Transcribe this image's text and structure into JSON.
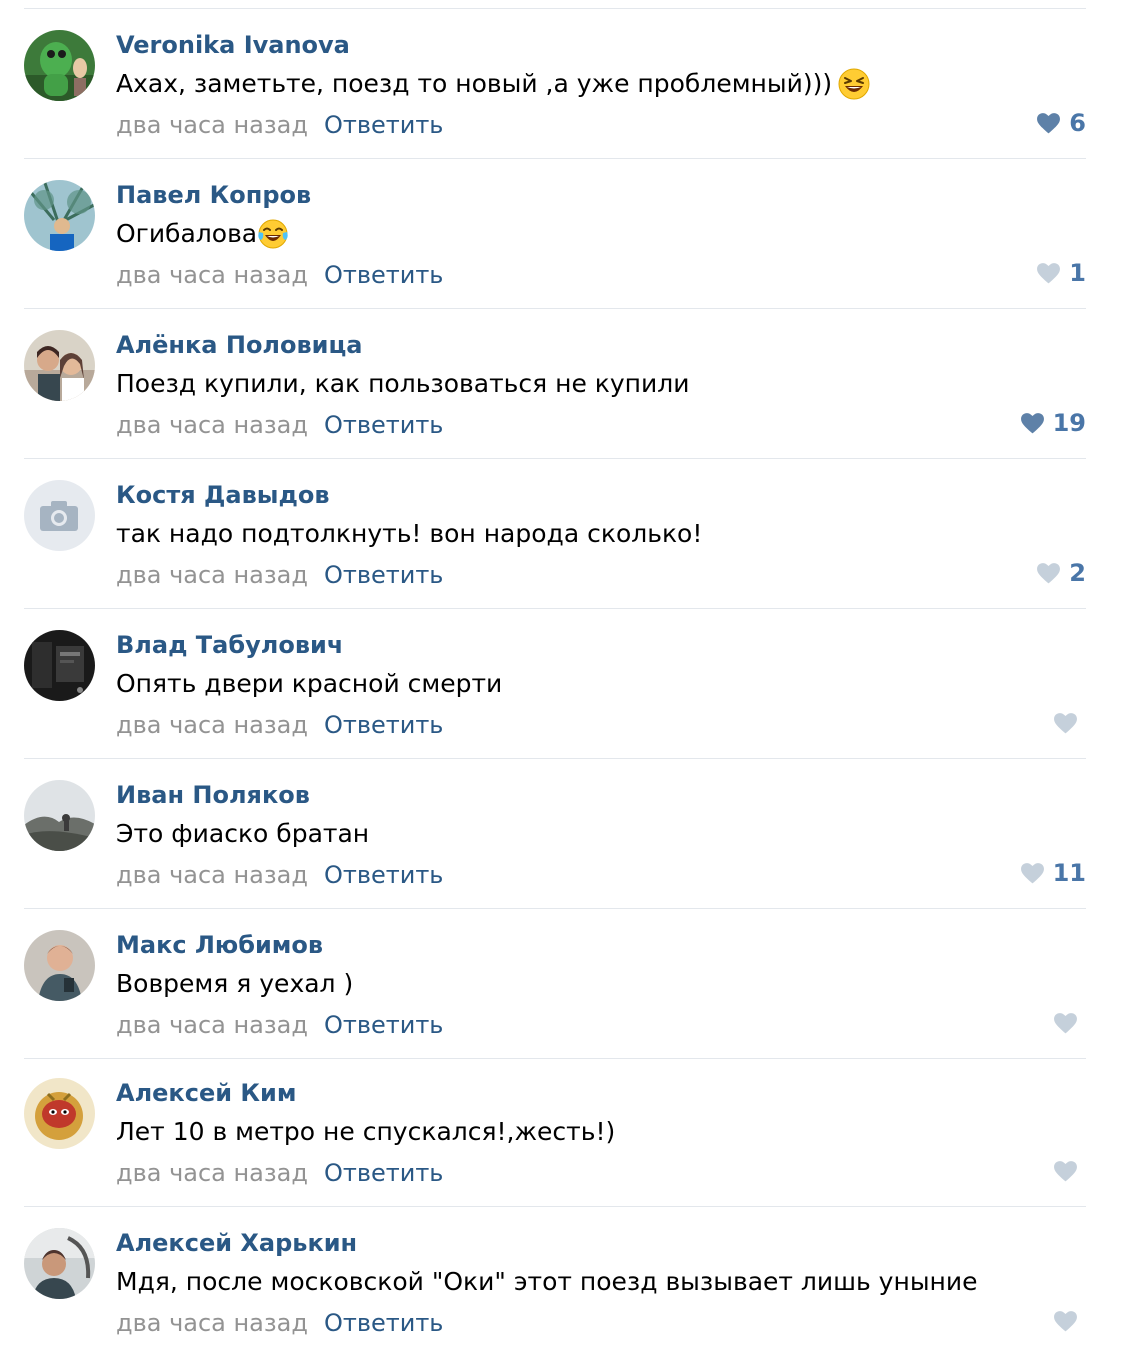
{
  "comments": [
    {
      "author": "Veronika Ivanova",
      "text": "Ахах, заметьте, поезд то новый ,а уже проблемный)))",
      "emoji": "laughing-squint-emoji",
      "time": "два часа назад",
      "reply_label": "Ответить",
      "likes": "6",
      "liked": true,
      "avatar": "avatar-green-toy-photo"
    },
    {
      "author": "Павел Копров",
      "text": "Огибалова",
      "emoji": "tears-of-joy-emoji",
      "time": "два часа назад",
      "reply_label": "Ответить",
      "likes": "1",
      "liked": false,
      "avatar": "avatar-tree-photo"
    },
    {
      "author": "Алёнка Половица",
      "text": "Поезд купили, как пользоваться не купили",
      "time": "два часа назад",
      "reply_label": "Ответить",
      "likes": "19",
      "liked": true,
      "avatar": "avatar-couple-photo"
    },
    {
      "author": "Костя Давыдов",
      "text": "так надо подтолкнуть! вон народа сколько!",
      "time": "два часа назад",
      "reply_label": "Ответить",
      "likes": "2",
      "liked": false,
      "avatar": "avatar-placeholder-camera"
    },
    {
      "author": "Влад Табулович",
      "text": "Опять двери красной смерти",
      "time": "два часа назад",
      "reply_label": "Ответить",
      "likes": "",
      "liked": false,
      "avatar": "avatar-dark-photo"
    },
    {
      "author": "Иван Поляков",
      "text": "Это фиаско братан",
      "time": "два часа назад",
      "reply_label": "Ответить",
      "likes": "11",
      "liked": false,
      "avatar": "avatar-landscape-photo"
    },
    {
      "author": "Макс Любимов",
      "text": "Вовремя я уехал )",
      "time": "два часа назад",
      "reply_label": "Ответить",
      "likes": "",
      "liked": false,
      "avatar": "avatar-man-photo"
    },
    {
      "author": "Алексей Ким",
      "text": "Лет 10 в метро не спускался!,жесть!)",
      "time": "два часа назад",
      "reply_label": "Ответить",
      "likes": "",
      "liked": false,
      "avatar": "avatar-cartoon-photo"
    },
    {
      "author": "Алексей Харькин",
      "text": "Мдя, после московской \"Оки\" этот поезд вызывает лишь уныние",
      "time": "два часа назад",
      "reply_label": "Ответить",
      "likes": "",
      "liked": false,
      "avatar": "avatar-car-photo"
    }
  ],
  "colors": {
    "author": "#2a5885",
    "time": "#939393",
    "like_active": "#5e81a8",
    "like_inactive": "#c5d0db",
    "divider": "#e3e7ec"
  }
}
